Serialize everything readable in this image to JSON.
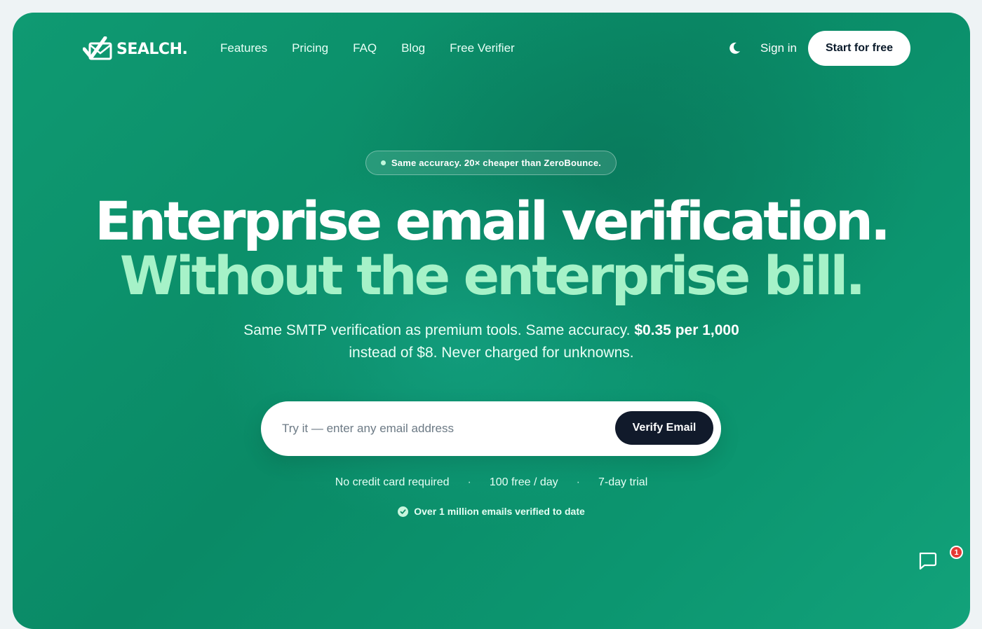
{
  "brand": {
    "name": "SEALCH."
  },
  "nav": {
    "links": [
      "Features",
      "Pricing",
      "FAQ",
      "Blog",
      "Free Verifier"
    ],
    "theme_icon": "moon-icon",
    "signin_label": "Sign in",
    "cta_label": "Start for free"
  },
  "hero": {
    "badge": "Same accuracy. 20× cheaper than ZeroBounce.",
    "headline_line1": "Enterprise email verification.",
    "headline_line2": "Without the enterprise bill.",
    "subtext_part1": "Same SMTP verification as premium tools. Same accuracy.",
    "subtext_bold": "$0.35 per 1,000",
    "subtext_part2": "instead of $8. Never charged for unknowns."
  },
  "form": {
    "placeholder": "Try it — enter any email address",
    "value": "",
    "submit_label": "Verify Email"
  },
  "perks": [
    "No credit card required",
    "100 free / day",
    "7-day trial"
  ],
  "perk_separator": "·",
  "proof": {
    "icon": "check-circle-icon",
    "text": "Over 1 million emails verified to date"
  },
  "chat": {
    "icon": "chat-bubble-icon",
    "unread_count": "1"
  },
  "colors": {
    "hero_green": "#0c9670",
    "headline_accent": "#a6f2c8",
    "button_dark": "#111a2b"
  }
}
